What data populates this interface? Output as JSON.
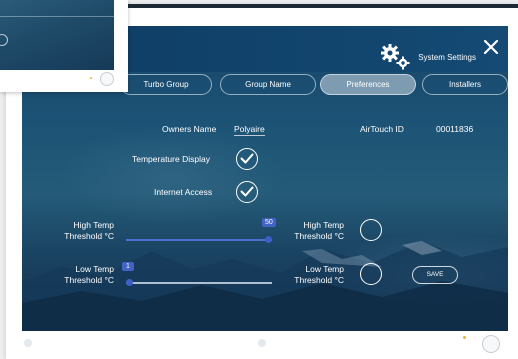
{
  "header": {
    "title": "System Settings",
    "icons": {
      "settings": "gear-icon",
      "close": "close-icon"
    }
  },
  "tabs": [
    {
      "label": "Turbo Group",
      "active": false
    },
    {
      "label": "Group Name",
      "active": false
    },
    {
      "label": "Preferences",
      "active": true
    },
    {
      "label": "Installers",
      "active": false
    }
  ],
  "preferences": {
    "owners_name_label": "Owners Name",
    "owners_name_value": "Polyaire",
    "airtouch_id_label": "AirTouch ID",
    "airtouch_id_value": "00011836",
    "temperature_display_label": "Temperature Display",
    "temperature_display_checked": true,
    "internet_access_label": "Internet Access",
    "internet_access_checked": true,
    "high_temp_label_line1": "High Temp",
    "high_temp_label_line2": "Threshold °C",
    "high_temp_value": "50",
    "high_temp_fraction": 1.0,
    "high_temp_toggle_label_line1": "High Temp",
    "high_temp_toggle_label_line2": "Threshold °C",
    "low_temp_label_line1": "Low Temp",
    "low_temp_label_line2": "Threshold °C",
    "low_temp_value": "1",
    "low_temp_fraction": 0.0,
    "low_temp_toggle_label_line1": "Low Temp",
    "low_temp_toggle_label_line2": "Threshold °C",
    "save_label": "SAVE"
  },
  "colors": {
    "accent": "#4262c4",
    "title_bar": "#0e3c63"
  }
}
